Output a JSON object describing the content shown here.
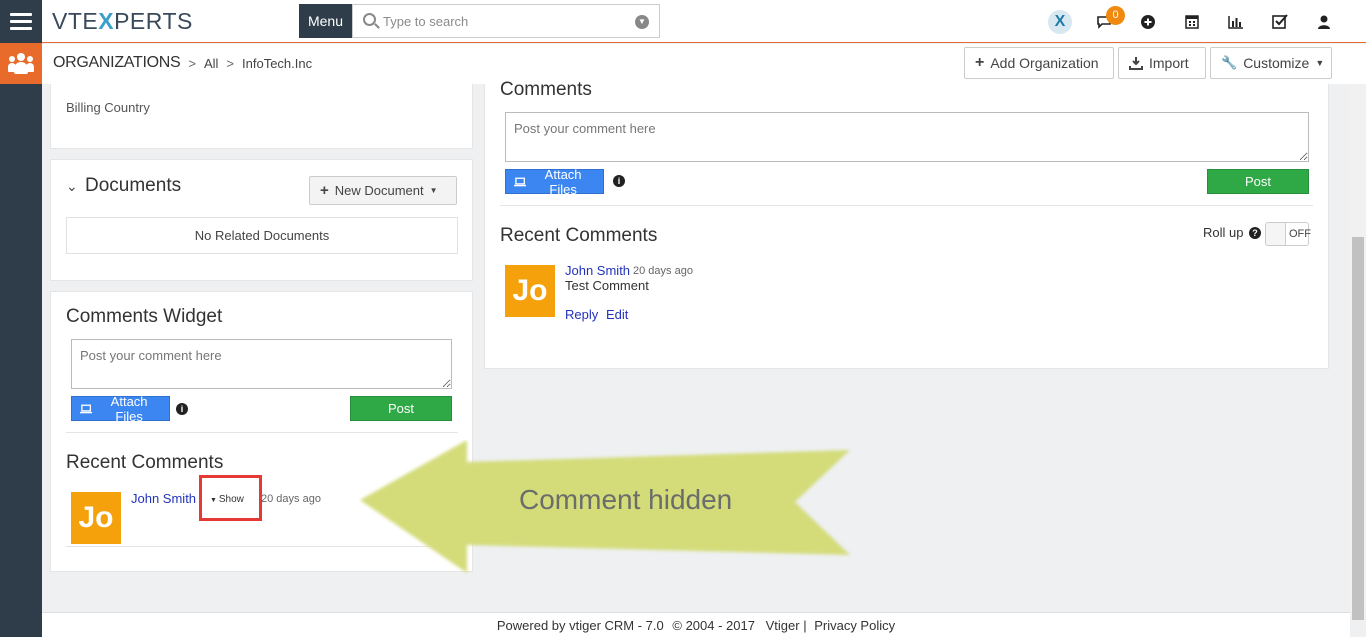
{
  "topbar": {
    "logo_text_a": "VTE",
    "logo_text_x": "X",
    "logo_text_b": "PERTS",
    "menu_label": "Menu",
    "search_placeholder": "Type to search",
    "notification_count": "0",
    "icons": [
      "vtexperts-x-icon",
      "chat-icon",
      "plus-circle-icon",
      "calendar-icon",
      "reports-chart-icon",
      "tasks-check-icon",
      "user-icon"
    ]
  },
  "breadcrumb": {
    "module": "ORGANIZATIONS",
    "filter": "All",
    "record": "InfoTech.Inc"
  },
  "header_buttons": {
    "add_org": "Add Organization",
    "import": "Import",
    "customize": "Customize"
  },
  "left": {
    "billing_country_label": "Billing Country",
    "documents": {
      "title": "Documents",
      "new_button": "New Document",
      "empty_text": "No Related Documents"
    },
    "comments_widget": {
      "title": "Comments Widget",
      "placeholder": "Post your comment here",
      "attach_label": "Attach Files",
      "post_label": "Post",
      "recent_title": "Recent Comments",
      "comment": {
        "avatar": "Jo",
        "author": "John Smith",
        "show_label": "Show",
        "time": "20 days ago"
      }
    }
  },
  "right": {
    "comments_title": "Comments",
    "placeholder": "Post your comment here",
    "attach_label": "Attach Files",
    "post_label": "Post",
    "recent_title": "Recent Comments",
    "rollup_label": "Roll up",
    "rollup_state": "OFF",
    "comment": {
      "avatar": "Jo",
      "author": "John Smith",
      "time": "20 days ago",
      "text": "Test Comment",
      "reply": "Reply",
      "edit": "Edit"
    }
  },
  "annotation": {
    "text": "Comment hidden",
    "arrow_color": "#d4dc7a",
    "highlight_color": "#e53935"
  },
  "footer": {
    "powered": "Powered by vtiger CRM - 7.0",
    "copyright": "© 2004 - 2017",
    "vtiger_link": "Vtiger",
    "privacy_link": "Privacy Policy"
  },
  "colors": {
    "accent_orange": "#e96b2c",
    "sidebar_dark": "#2f3d4a",
    "attach_blue": "#3c86f1",
    "post_green": "#2fa846",
    "avatar_orange": "#f5a10c"
  }
}
